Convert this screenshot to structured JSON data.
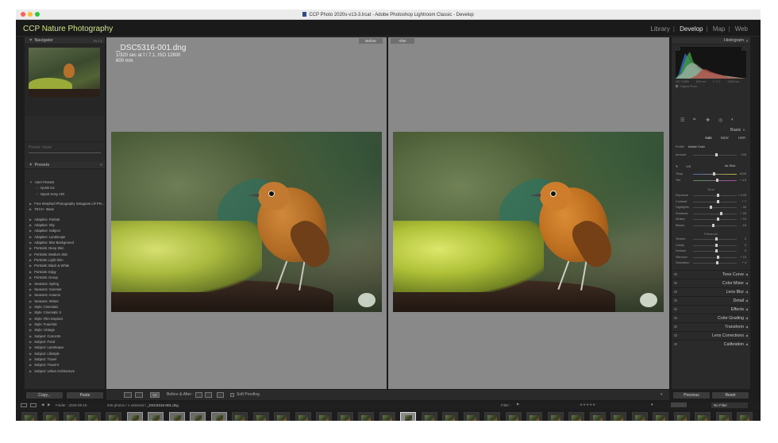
{
  "window": {
    "title": "CCP Photo 2020s-v13-3.lrcat - Adobe Photoshop Lightroom Classic - Develop"
  },
  "identity": {
    "brand": "CCP Nature Photography",
    "modules": [
      "Library",
      "Develop",
      "Map",
      "Web"
    ],
    "active_module": "Develop"
  },
  "left": {
    "navigator": {
      "label": "Navigator",
      "zoom": "Fit 1:1",
      "snap1": "Preset: None",
      "snap2": "Amount"
    },
    "presets": {
      "label": "Presets",
      "items": [
        {
          "t": "User Presets",
          "kind": "group"
        },
        {
          "t": "Ajuste luz",
          "kind": "sub"
        },
        {
          "t": "Import Sony ARI",
          "kind": "sub"
        },
        {
          "t": "Free Morphed Photography Instagram LR Pre...",
          "kind": "group",
          "gap": true
        },
        {
          "t": "TECH - Base",
          "kind": "group"
        },
        {
          "t": "Adaptive: Portrait",
          "kind": "group",
          "gap": true
        },
        {
          "t": "Adaptive: Sky",
          "kind": "group"
        },
        {
          "t": "Adaptive: Subject",
          "kind": "group"
        },
        {
          "t": "Adaptive: Landscape",
          "kind": "group"
        },
        {
          "t": "Adaptive: Blur Background",
          "kind": "group"
        },
        {
          "t": "Portraits: Deep Skin",
          "kind": "group"
        },
        {
          "t": "Portraits: Medium Skin",
          "kind": "group"
        },
        {
          "t": "Portraits: Light Skin",
          "kind": "group"
        },
        {
          "t": "Portraits: Black & White",
          "kind": "group"
        },
        {
          "t": "Portraits: Edgy",
          "kind": "group"
        },
        {
          "t": "Portraits: Group",
          "kind": "group"
        },
        {
          "t": "Seasons: Spring",
          "kind": "group"
        },
        {
          "t": "Seasons: Summer",
          "kind": "group"
        },
        {
          "t": "Seasons: Autumn",
          "kind": "group"
        },
        {
          "t": "Seasons: Winter",
          "kind": "group"
        },
        {
          "t": "Style: Cinematic",
          "kind": "group"
        },
        {
          "t": "Style: Cinematic II",
          "kind": "group"
        },
        {
          "t": "Style: Film Inspired",
          "kind": "group"
        },
        {
          "t": "Style: Futuristic",
          "kind": "group"
        },
        {
          "t": "Style: Vintage",
          "kind": "group"
        },
        {
          "t": "Subject: Concerts",
          "kind": "group"
        },
        {
          "t": "Subject: Food",
          "kind": "group"
        },
        {
          "t": "Subject: Landscape",
          "kind": "group"
        },
        {
          "t": "Subject: Lifestyle",
          "kind": "group"
        },
        {
          "t": "Subject: Travel",
          "kind": "group"
        },
        {
          "t": "Subject: Travel II",
          "kind": "group"
        },
        {
          "t": "Subject: Urban Architecture",
          "kind": "group"
        }
      ]
    },
    "copy_label": "Copy...",
    "paste_label": "Paste"
  },
  "center": {
    "filename": "_DSC5316-001.dng",
    "exif": "1/320 sec at f / 7.1, ISO 12800",
    "lens": "600 mm",
    "before_label": "Before",
    "after_label": "After",
    "toolbar": {
      "before_after": "Before & After :",
      "soft_proofing": "Soft Proofing"
    }
  },
  "right": {
    "histogram_label": "Histogram",
    "hist_stats": [
      "ISO 12800",
      "600 mm",
      "f / 7.1",
      "1/320 sec"
    ],
    "original_photo": "Original Photo",
    "basic_label": "Basic",
    "treatments": [
      "Auto",
      "B&W",
      "HDR"
    ],
    "profile": {
      "label": "Profile",
      "value": "Adobe Color"
    },
    "amount": {
      "label": "Amount",
      "value": "100"
    },
    "wb": {
      "label": "WB",
      "value": "As Shot"
    },
    "temp": {
      "label": "Temp",
      "value": "4100"
    },
    "tint": {
      "label": "Tint",
      "value": "+ 4.0"
    },
    "tone_label": "Tone",
    "sliders": [
      {
        "label": "Exposure",
        "value": "+ 0.25",
        "pos": 0.55
      },
      {
        "label": "Contrast",
        "value": "+ 7",
        "pos": 0.54
      },
      {
        "label": "Highlights",
        "value": "- 30",
        "pos": 0.38
      },
      {
        "label": "Shadows",
        "value": "+ 25",
        "pos": 0.62
      },
      {
        "label": "Whites",
        "value": "+ 10",
        "pos": 0.55
      },
      {
        "label": "Blacks",
        "value": "- 15",
        "pos": 0.43
      }
    ],
    "presence_label": "Presence",
    "presence": [
      {
        "label": "Texture",
        "value": "0",
        "pos": 0.5
      },
      {
        "label": "Clarity",
        "value": "0",
        "pos": 0.5
      },
      {
        "label": "Dehaze",
        "value": "0",
        "pos": 0.5
      },
      {
        "label": "Vibrance",
        "value": "+ 10",
        "pos": 0.55
      },
      {
        "label": "Saturation",
        "value": "+ 4",
        "pos": 0.52
      }
    ],
    "sections": [
      "Tone Curve",
      "Color Mixer",
      "Lens Blur",
      "Detail",
      "Effects",
      "Color Grading",
      "Transform",
      "Lens Corrections",
      "Calibration"
    ],
    "previous_label": "Previous",
    "reset_label": "Reset"
  },
  "filmstrip": {
    "folder": "Folder : 2025-09-18",
    "count": "645 photos / 1 selected /",
    "current": "_DSC5316-001.dng",
    "filter_label": "Filter :",
    "filter_value": "No Filter"
  }
}
